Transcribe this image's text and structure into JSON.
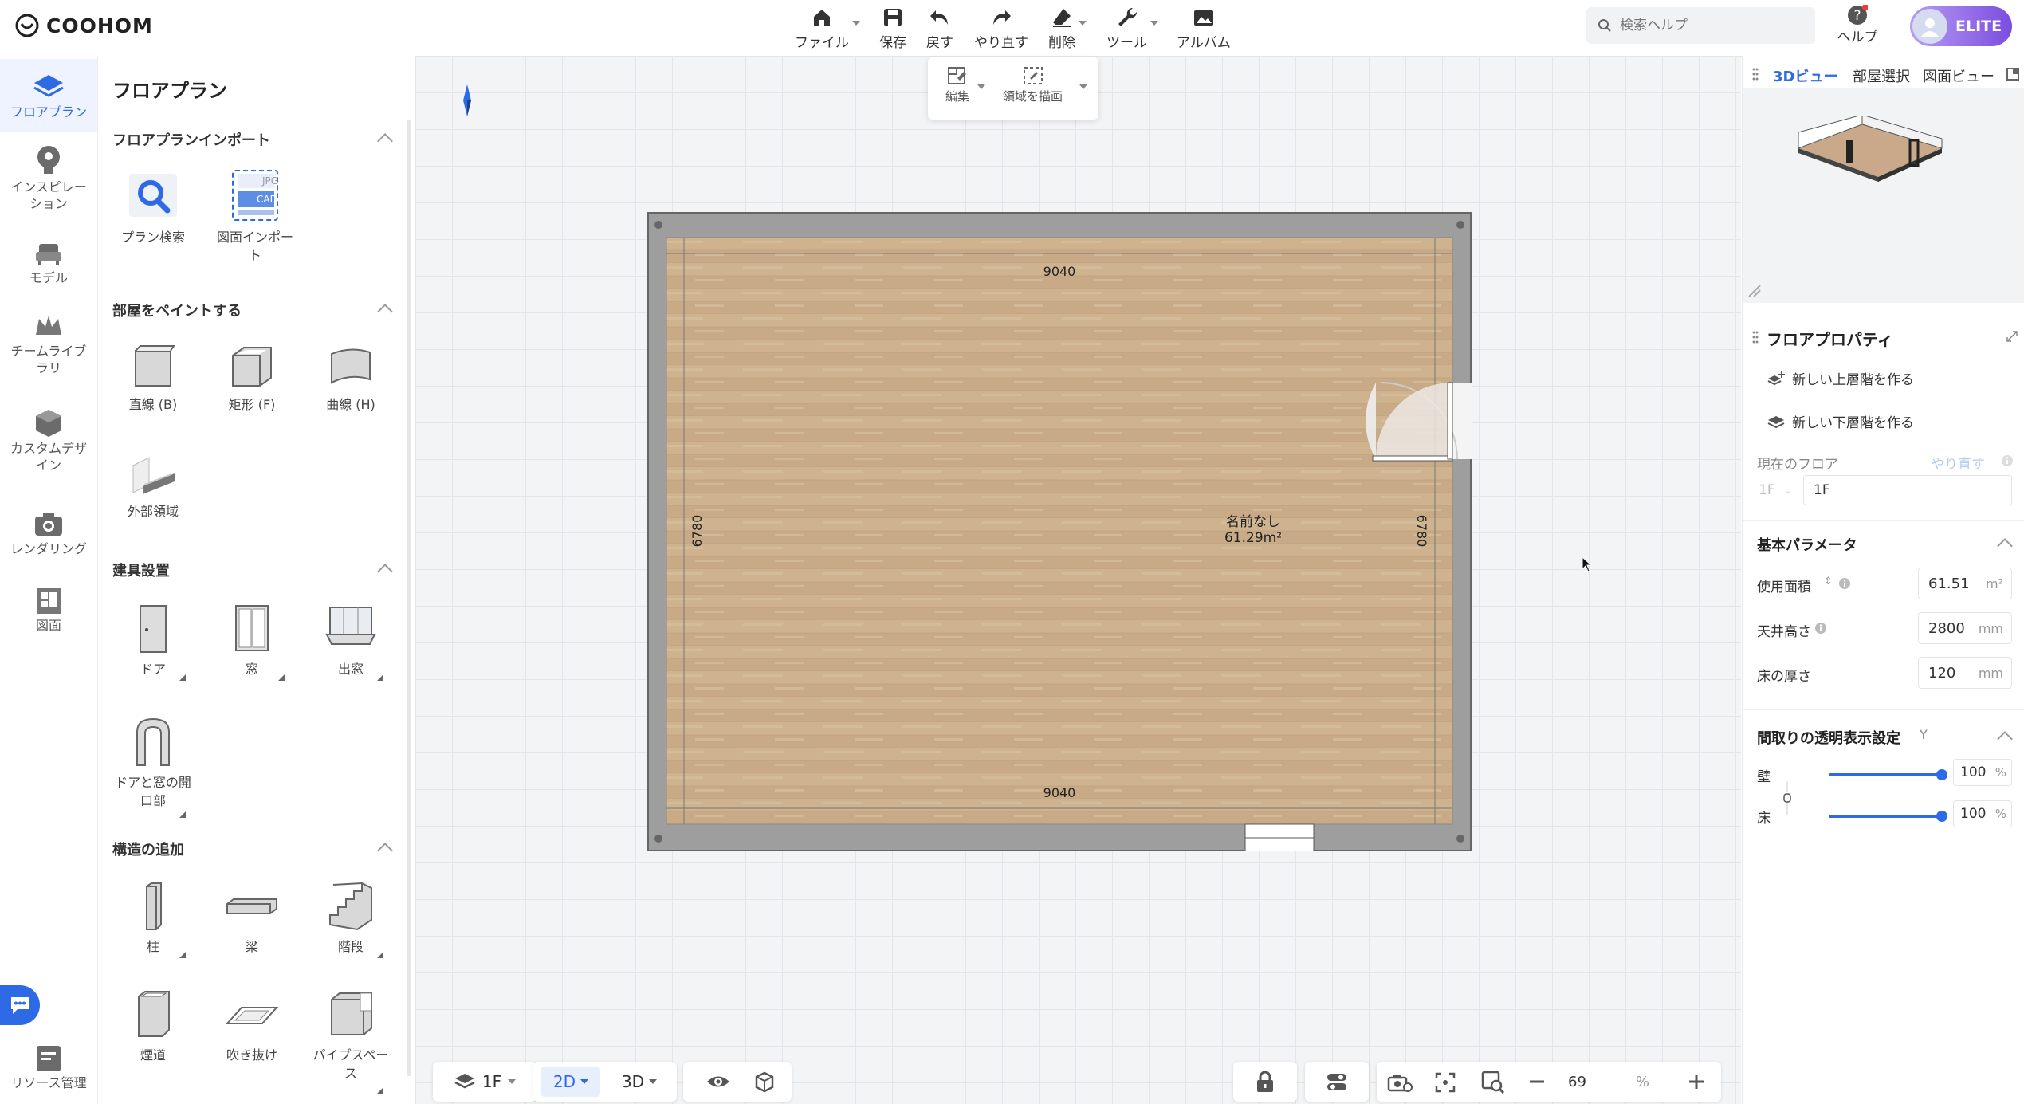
{
  "app": {
    "logo_text": "COOHOM"
  },
  "toolbar": {
    "items": [
      {
        "label": "ファイル",
        "icon": "home-icon"
      },
      {
        "label": "保存",
        "icon": "save-icon"
      },
      {
        "label": "戻す",
        "icon": "undo-icon"
      },
      {
        "label": "やり直す",
        "icon": "redo-icon"
      },
      {
        "label": "削除",
        "icon": "eraser-icon"
      },
      {
        "label": "ツール",
        "icon": "wrench-icon"
      },
      {
        "label": "アルバム",
        "icon": "album-icon"
      }
    ],
    "search_placeholder": "検索ヘルプ",
    "help_label": "ヘルプ",
    "elite_label": "ELITE"
  },
  "leftnav": {
    "items": [
      {
        "label": "フロアプラン",
        "icon": "floorplan-icon",
        "active": true
      },
      {
        "label": "インスピレーション",
        "icon": "lightbulb-icon"
      },
      {
        "label": "モデル",
        "icon": "sofa-icon"
      },
      {
        "label": "チームライブラリ",
        "icon": "crown-icon"
      },
      {
        "label": "カスタムデザイン",
        "icon": "custom-design-icon"
      },
      {
        "label": "レンダリング",
        "icon": "camera-icon"
      },
      {
        "label": "図面",
        "icon": "drawing-icon"
      },
      {
        "label": "リソース管理",
        "icon": "resource-icon"
      }
    ]
  },
  "panel": {
    "title": "フロアプラン",
    "sections": {
      "import": {
        "title": "フロアプランインポート",
        "items": [
          "プラン検索",
          "図面インポート"
        ]
      },
      "paint": {
        "title": "部屋をペイントする",
        "items": [
          "直線 (B)",
          "矩形 (F)",
          "曲線 (H)",
          "外部領域"
        ]
      },
      "fixtures": {
        "title": "建具設置",
        "items": [
          "ドア",
          "窓",
          "出窓",
          "ドアと窓の開口部"
        ]
      },
      "structure": {
        "title": "構造の追加",
        "items": [
          "柱",
          "梁",
          "階段",
          "煙道",
          "吹き抜け",
          "パイプスペース"
        ]
      }
    },
    "import_badges": {
      "jpg": "JPG",
      "cad": "CAD"
    }
  },
  "canvas": {
    "subtoolbar": [
      "編集",
      "領域を描画"
    ],
    "room": {
      "name": "名前なし",
      "area": "61.29m²"
    },
    "dimensions": {
      "top": "9040",
      "bottom": "9040",
      "left": "6780",
      "right": "6780"
    }
  },
  "rightpanel": {
    "tabs": [
      "3Dビュー",
      "部屋選択",
      "図面ビュー"
    ],
    "props_title": "フロアプロパティ",
    "new_upper": "新しい上層階を作る",
    "new_lower": "新しい下層階を作る",
    "current_floor_label": "現在のフロア",
    "redo_link": "やり直す",
    "floor_select": "1F",
    "floor_name": "1F",
    "basic_params_title": "基本パラメータ",
    "params": [
      {
        "label": "使用面積",
        "value": "61.51",
        "unit": "m²"
      },
      {
        "label": "天井高さ",
        "value": "2800",
        "unit": "mm"
      },
      {
        "label": "床の厚さ",
        "value": "120",
        "unit": "mm"
      }
    ],
    "transparency_title": "間取りの透明表示設定",
    "transparency_shortcut": "Y",
    "sliders": [
      {
        "label": "壁",
        "value": "100",
        "unit": "%",
        "level": 1.0
      },
      {
        "label": "床",
        "value": "100",
        "unit": "%",
        "level": 1.0
      }
    ]
  },
  "bottombar": {
    "floor": "1F",
    "view_2d": "2D",
    "view_3d": "3D",
    "zoom": "69",
    "zoom_unit": "%"
  }
}
